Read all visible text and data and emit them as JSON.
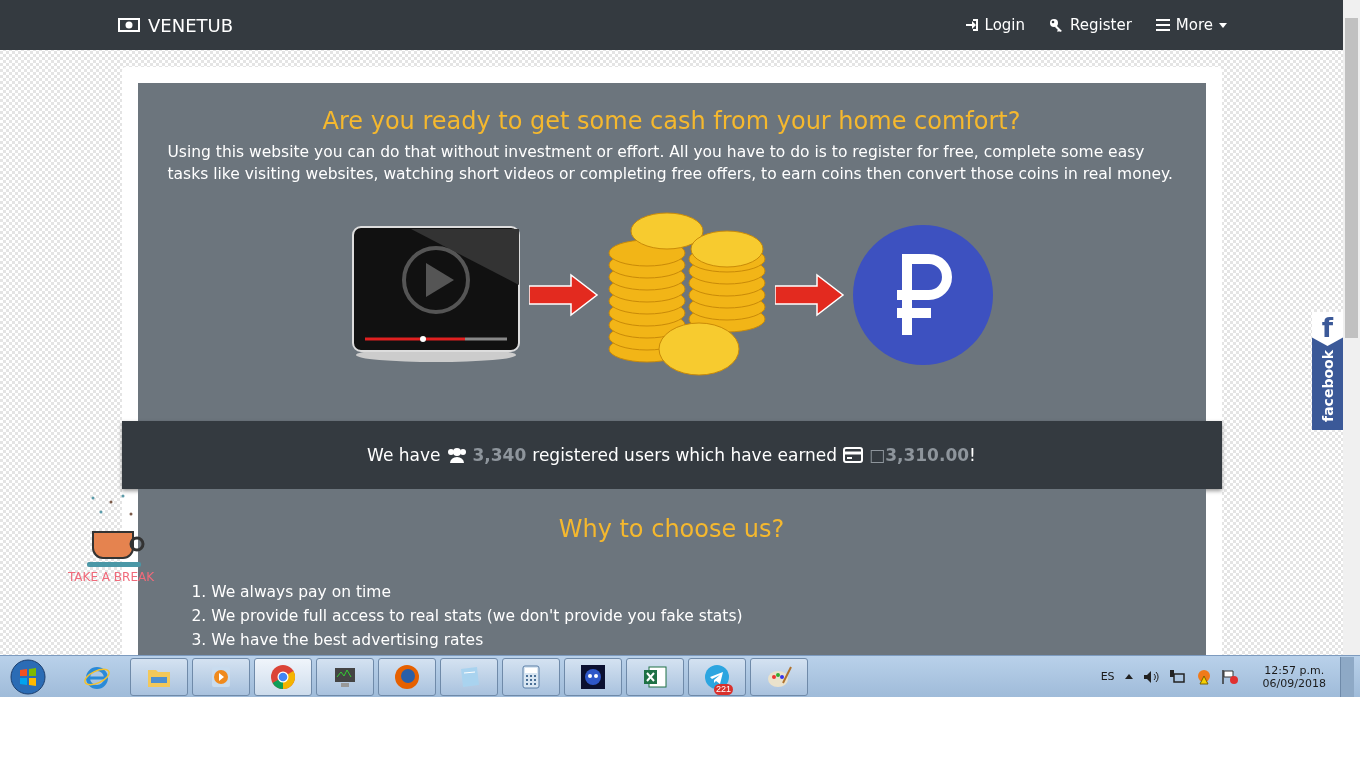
{
  "navbar": {
    "brand": "VENETUB",
    "links": [
      {
        "label": "Login",
        "kind": "login"
      },
      {
        "label": "Register",
        "kind": "register"
      },
      {
        "label": "More",
        "kind": "more"
      }
    ]
  },
  "hero": {
    "title": "Are you ready to get some cash from your home comfort?",
    "text": "Using this website you can do that without investment or effort. All you have to do is to register for free, complete some easy tasks like visiting websites, watching short videos or completing free offers, to earn coins then convert those coins in real money."
  },
  "stats": {
    "prefix": "We have",
    "users": "3,340",
    "middle": "registered users which have earned",
    "amount": "□3,310.00",
    "suffix": "!"
  },
  "why": {
    "title": "Why to choose us?",
    "items": [
      "1. We always pay on time",
      "2. We provide full access to real stats (we don't provide you fake stats)",
      "3. We have the best advertising rates"
    ]
  },
  "take_a_break": {
    "label": "TAKE A BREAK"
  },
  "facebook_tab": {
    "letter": "f",
    "label": "facebook"
  },
  "taskbar": {
    "apps": [
      {
        "kind": "ie",
        "selected": false
      },
      {
        "kind": "folder",
        "selected": false
      },
      {
        "kind": "media",
        "selected": false
      },
      {
        "kind": "chrome",
        "selected": true
      },
      {
        "kind": "monitor",
        "selected": false
      },
      {
        "kind": "firefox",
        "selected": false
      },
      {
        "kind": "notepad",
        "selected": false
      },
      {
        "kind": "calculator",
        "selected": false
      },
      {
        "kind": "game",
        "selected": false
      },
      {
        "kind": "excel",
        "selected": false
      },
      {
        "kind": "telegram",
        "selected": false,
        "badge": "221"
      },
      {
        "kind": "paint",
        "selected": false
      }
    ]
  },
  "tray": {
    "language": "ES",
    "time": "12:57 p.m.",
    "date": "06/09/2018"
  }
}
